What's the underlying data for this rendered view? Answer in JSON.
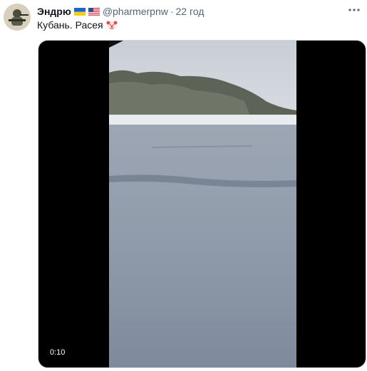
{
  "tweet": {
    "author_name": "Эндрю",
    "handle": "@pharmerpnw",
    "separator": "·",
    "time": "22 год",
    "text": "Кубань. Расея",
    "icons": {
      "avatar": "avatar-image",
      "flag_1": "ukraine-flag-icon",
      "flag_2": "us-flag-icon",
      "emoji": "clown-face-icon",
      "more": "more-options-icon"
    }
  },
  "media": {
    "duration": "0:10"
  },
  "colors": {
    "text_primary": "#0f1419",
    "text_secondary": "#536471",
    "media_background": "#000000"
  }
}
